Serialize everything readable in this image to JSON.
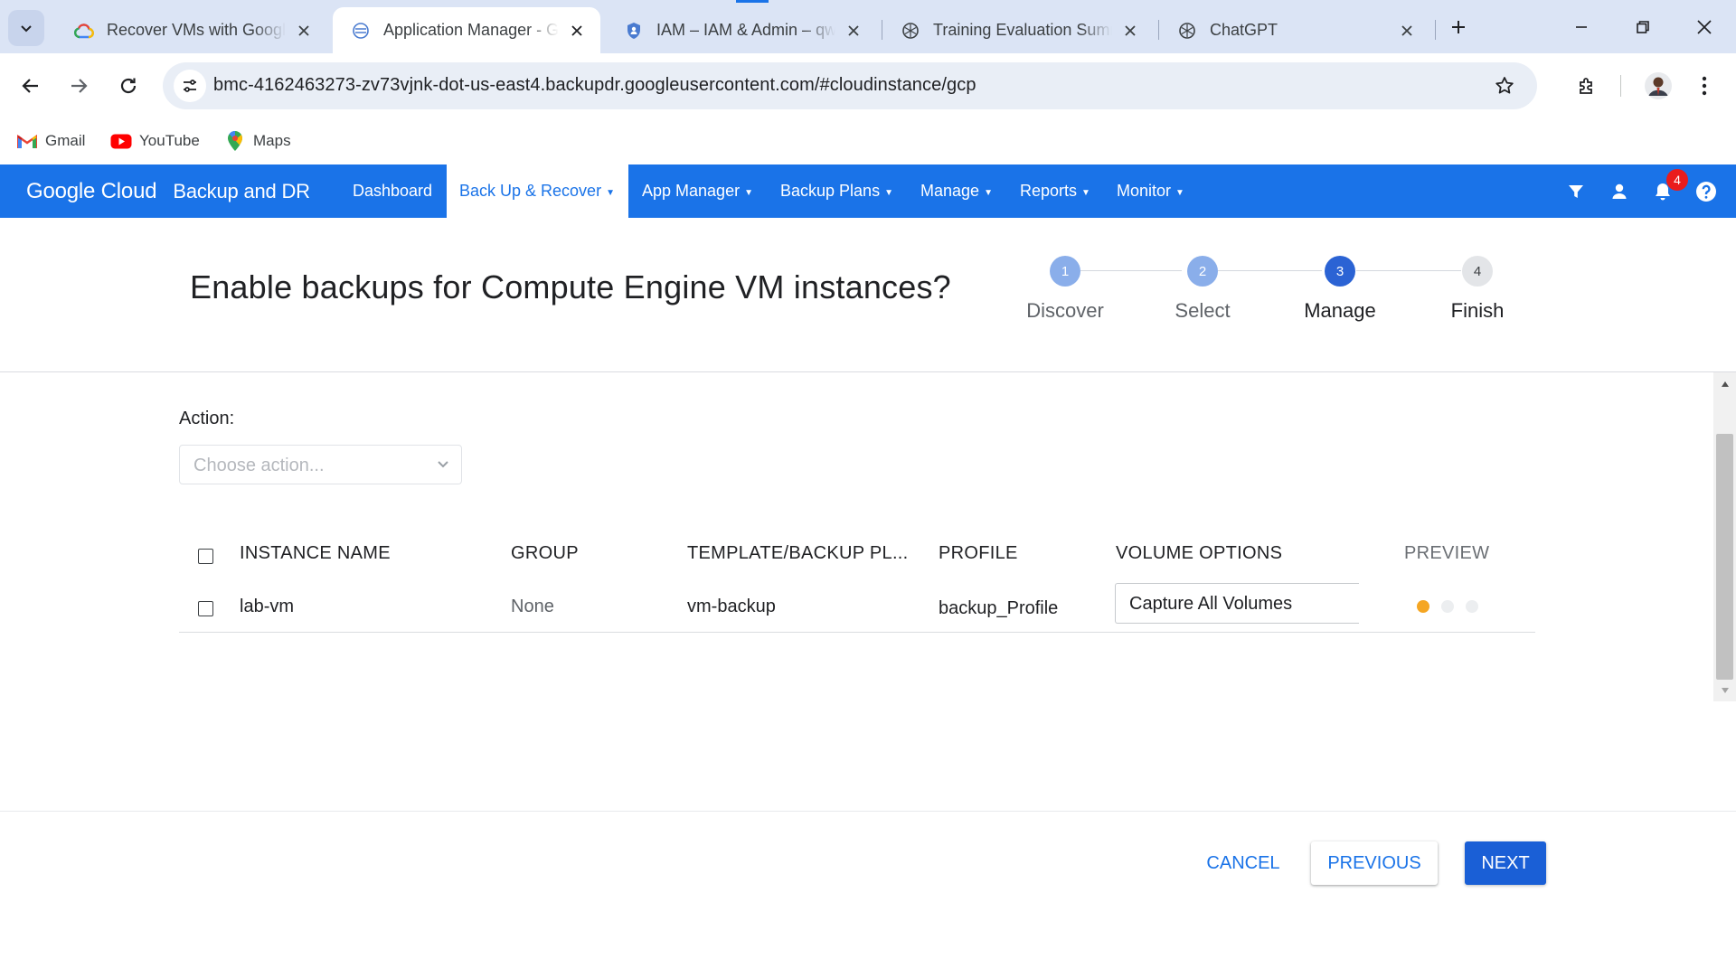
{
  "browser": {
    "tabs": [
      {
        "title": "Recover VMs with Google",
        "favicon": "google-cloud-icon",
        "active": false
      },
      {
        "title": "Application Manager - Go",
        "favicon": "globe-icon",
        "active": true
      },
      {
        "title": "IAM – IAM & Admin – qw",
        "favicon": "shield-icon",
        "active": false
      },
      {
        "title": "Training Evaluation Summ",
        "favicon": "chatgpt-icon",
        "active": false
      },
      {
        "title": "ChatGPT",
        "favicon": "chatgpt-icon",
        "active": false
      }
    ],
    "url": "bmc-4162463273-zv73vjnk-dot-us-east4.backupdr.googleusercontent.com/#cloudinstance/gcp",
    "bookmarks": [
      {
        "label": "Gmail",
        "icon": "gmail-icon"
      },
      {
        "label": "YouTube",
        "icon": "youtube-icon"
      },
      {
        "label": "Maps",
        "icon": "maps-pin-icon"
      }
    ]
  },
  "app": {
    "brand": "Google Cloud",
    "product": "Backup and DR",
    "nav": [
      {
        "label": "Dashboard",
        "caret": ""
      },
      {
        "label": "Back Up & Recover",
        "caret": "▼",
        "active": true
      },
      {
        "label": "App Manager",
        "caret": "▼"
      },
      {
        "label": "Backup Plans",
        "caret": "▼"
      },
      {
        "label": "Manage",
        "caret": "▼"
      },
      {
        "label": "Reports",
        "caret": "▼"
      },
      {
        "label": "Monitor",
        "caret": "▼"
      }
    ],
    "notification_count": "4",
    "colors": {
      "primary": "#1a73e8",
      "badge": "#ea1c1c",
      "preview_active": "#f5a623"
    }
  },
  "wizard": {
    "title": "Enable backups for Compute Engine VM instances?",
    "steps": [
      {
        "number": "1",
        "label": "Discover",
        "state": "done"
      },
      {
        "number": "2",
        "label": "Select",
        "state": "done"
      },
      {
        "number": "3",
        "label": "Manage",
        "state": "current"
      },
      {
        "number": "4",
        "label": "Finish",
        "state": "upcoming"
      }
    ]
  },
  "action": {
    "label": "Action:",
    "placeholder": "Choose action..."
  },
  "table": {
    "headers": {
      "instance_name": "INSTANCE NAME",
      "group": "GROUP",
      "template": "TEMPLATE/BACKUP PL...",
      "profile": "PROFILE",
      "volume_options": "VOLUME OPTIONS",
      "preview": "PREVIEW"
    },
    "rows": [
      {
        "instance_name": "lab-vm",
        "group": "None",
        "template": "vm-backup",
        "profile": "backup_Profile",
        "volume_options": "Capture All Volumes",
        "preview_step": 1,
        "preview_total": 3
      }
    ]
  },
  "footer": {
    "cancel": "CANCEL",
    "previous": "PREVIOUS",
    "next": "NEXT"
  }
}
